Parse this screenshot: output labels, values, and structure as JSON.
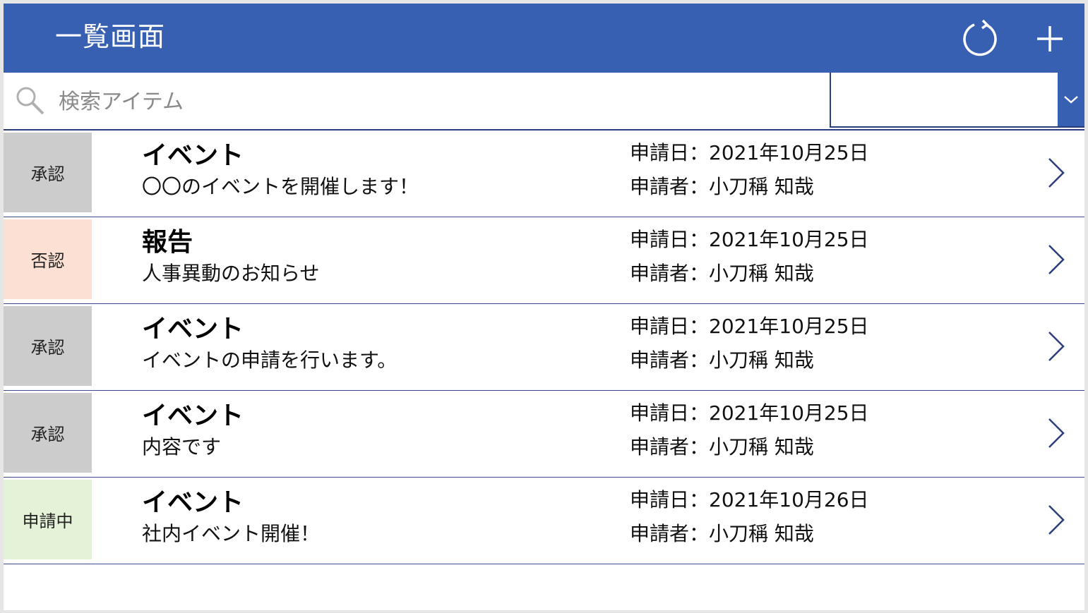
{
  "header": {
    "title": "一覧画面",
    "color": "#3860b2",
    "icons": [
      "refresh-icon",
      "add-icon"
    ]
  },
  "search": {
    "placeholder": "検索アイテム",
    "value": "",
    "filter_value": ""
  },
  "status_colors": {
    "承認": "#cccccc",
    "否認": "#fde0d4",
    "申請中": "#e4f3d8"
  },
  "items": [
    {
      "status": "承認",
      "title": "イベント",
      "subtitle": "〇〇のイベントを開催します！",
      "date": "申請日：2021年10月25日",
      "applicant": "申請者：小刀稱 知哉"
    },
    {
      "status": "否認",
      "title": "報告",
      "subtitle": "人事異動のお知らせ",
      "date": "申請日：2021年10月25日",
      "applicant": "申請者：小刀稱 知哉"
    },
    {
      "status": "承認",
      "title": "イベント",
      "subtitle": "イベントの申請を行います。",
      "date": "申請日：2021年10月25日",
      "applicant": "申請者：小刀稱 知哉"
    },
    {
      "status": "承認",
      "title": "イベント",
      "subtitle": "内容です",
      "date": "申請日：2021年10月25日",
      "applicant": "申請者：小刀稱 知哉"
    },
    {
      "status": "申請中",
      "title": "イベント",
      "subtitle": "社内イベント開催！",
      "date": "申請日：2021年10月26日",
      "applicant": "申請者：小刀稱 知哉"
    }
  ]
}
